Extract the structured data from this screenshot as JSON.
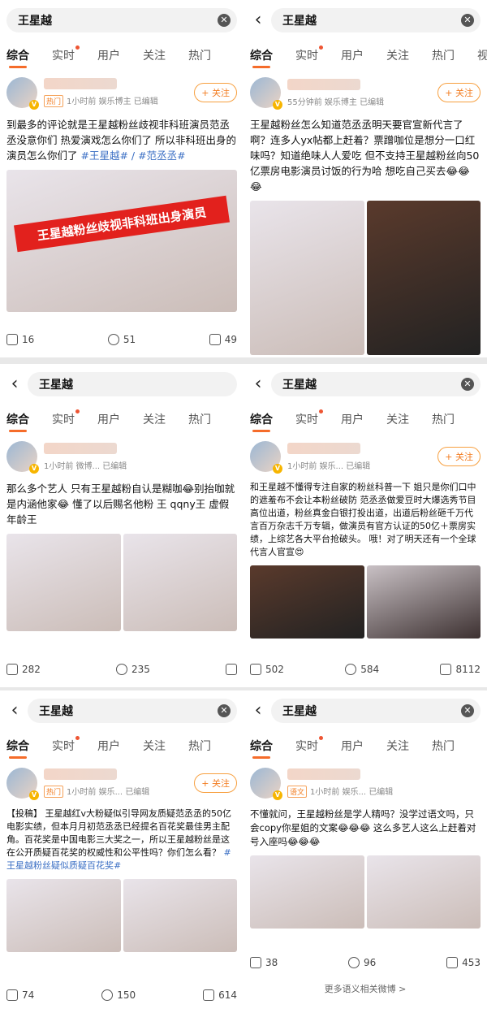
{
  "query": "王星越",
  "tabs": [
    "综合",
    "实时",
    "用户",
    "关注",
    "热门",
    "视"
  ],
  "p1": {
    "time": "1小时前",
    "src": "娱乐博主",
    "edited": "已编辑",
    "hot": "热门",
    "follow": "+ 关注",
    "body": "到最多的评论就是王星越粉丝歧视非科班演员范丞丞没意你们 热爱演戏怎么你们了 所以非科班出身的演员怎么你们了",
    "tags": "#王星越# / #范丞丞#",
    "overlay": "王星越粉丝歧视非科班出身演员",
    "stats": [
      "16",
      "51",
      "49"
    ]
  },
  "p2": {
    "time": "55分钟前",
    "src": "娱乐博主",
    "edited": "已编辑",
    "follow": "+ 关注",
    "body": "王星越粉丝怎么知道范丞丞明天要官宣新代言了啊？连多人yx帖都上赶着？票蹭咖位是想分一口红味吗？知道绝味人人爱吃 但不支持王星越粉丝向50亿票房电影演员讨饭的行为哈 想吃自己买去😂😂😂",
    "stats": []
  },
  "p3": {
    "time": "1小时前",
    "src": "微博...",
    "edited": "已编辑",
    "body": "那么多个艺人 只有王星越粉自认是糊咖😂别抬咖就是内涵他家😂 懂了以后赐名他粉 王 qqny王 虚假年龄王",
    "stats": [
      "282",
      "235"
    ]
  },
  "p4": {
    "time": "1小时前",
    "src": "娱乐...",
    "edited": "已编辑",
    "follow": "+ 关注",
    "body": "和王星越不懂得专注自家的粉丝科普一下 姐只是你们口中的遮羞布不会让本粉丝破防 范丞丞做爱豆时大爆选秀节目高位出道，粉丝真金白银打投出道，出道后粉丝砸千万代言百万杂志千万专辑，做演员有官方认证的50亿＋票房实绩，上综艺各大平台抢破头。 哦！对了明天还有一个全球代言人官宣😍",
    "stats": [
      "502",
      "584",
      "8112"
    ]
  },
  "p5": {
    "time": "1小时前",
    "src": "娱乐...",
    "edited": "已编辑",
    "hot": "热门",
    "follow": "+ 关注",
    "body": "【投稿】 王星越红v大粉疑似引导网友质疑范丞丞的50亿电影实绩，但本月月初范丞丞已经提名百花奖最佳男主配角。百花奖是中国电影三大奖之一，所以王星越粉丝是这在公开质疑百花奖的权威性和公平性吗？你们怎么看？",
    "tags": "#王星越粉丝疑似质疑百花奖#",
    "stats": [
      "74",
      "150",
      "614"
    ]
  },
  "p6": {
    "time": "1小时前",
    "src": "娱乐...",
    "edited": "已编辑",
    "hot": "语文",
    "body": "不懂就问，王星越粉丝是学人精吗？没学过语文吗，只会copy你星姐的文案😂😂😂 这么多艺人这么上赶着对号入座吗😂😂😂",
    "stats": [
      "38",
      "96",
      "453"
    ],
    "more": "更多语义相关微博 >"
  }
}
